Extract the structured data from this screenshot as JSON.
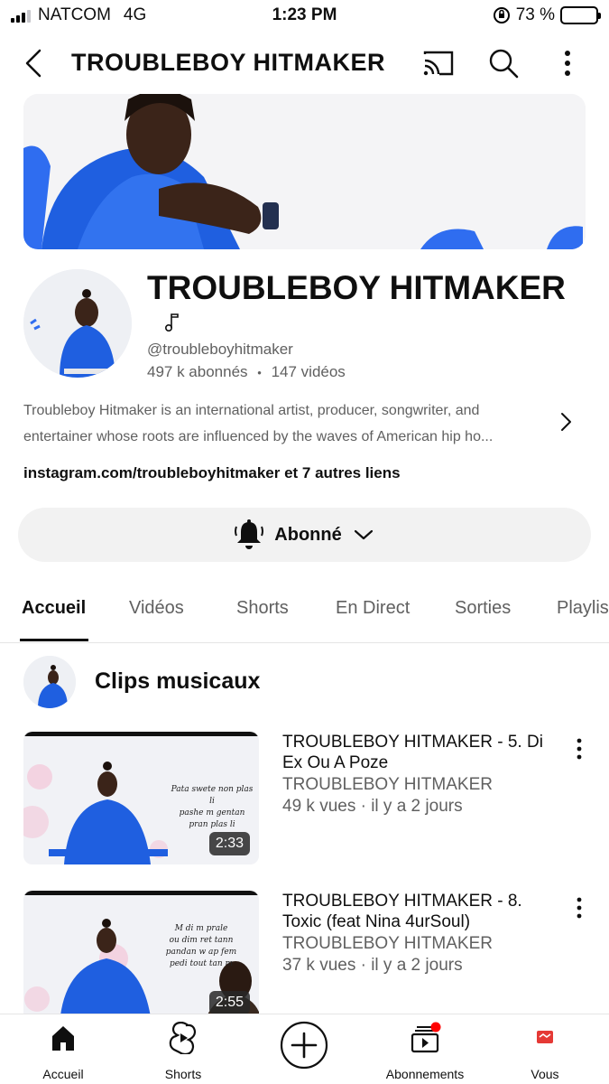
{
  "status_bar": {
    "carrier": "NATCOM",
    "network": "4G",
    "time": "1:23 PM",
    "battery": "73 %",
    "battery_level": 0.73
  },
  "header": {
    "title": "TROUBLEBOY HITMAKER"
  },
  "channel": {
    "name": "TROUBLEBOY HITMAKER",
    "handle": "@troubleboyhitmaker",
    "subscribers": "497 k abonnés",
    "separator": "•",
    "videos_count": "147 vidéos",
    "description_line1": "Troubleboy Hitmaker is an international artist, producer, songwriter, and",
    "description_line2": "entertainer whose roots are influenced by the waves of American hip ho...",
    "links": "instagram.com/troubleboyhitmaker et 7 autres liens",
    "subscribe_label": "Abonné"
  },
  "tabs": [
    "Accueil",
    "Vidéos",
    "Shorts",
    "En Direct",
    "Sorties",
    "Playlists"
  ],
  "section": {
    "title": "Clips musicaux"
  },
  "videos": [
    {
      "title": "TROUBLEBOY HITMAKER - 5. Di Ex Ou A Poze",
      "channel": "TROUBLEBOY HITMAKER",
      "meta": "49 k vues · il y a 2 jours",
      "duration": "2:33",
      "thumb_caption_lines": [
        "Pata swete non plas li",
        "pashe m gentan",
        "pran plas li"
      ]
    },
    {
      "title": "TROUBLEBOY HITMAKER - 8. Toxic (feat Nina 4urSoul)",
      "channel": "TROUBLEBOY HITMAKER",
      "meta": "37 k vues · il y a 2 jours",
      "duration": "2:55",
      "thumb_caption_lines": [
        "M di m prale",
        "ou dim ret tann",
        "pandan w ap fem",
        "pedi tout tan m"
      ]
    }
  ],
  "bottom_nav": {
    "home": "Accueil",
    "shorts": "Shorts",
    "subscriptions": "Abonnements",
    "you": "Vous"
  },
  "colors": {
    "accent": "#0f0f0f",
    "secondary_text": "#606060",
    "jacket_blue": "#1f5fe0",
    "notification_red": "#ff0000",
    "battery_green": "#34c759"
  }
}
